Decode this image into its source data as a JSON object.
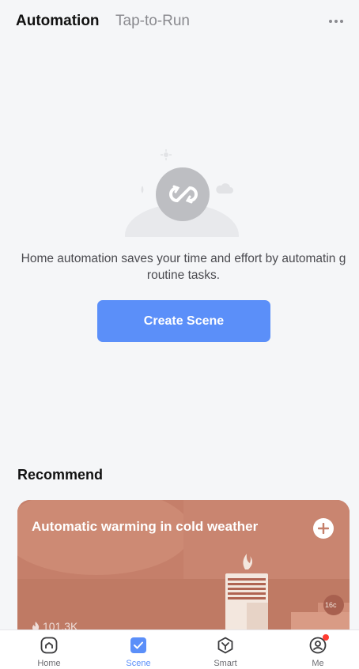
{
  "header": {
    "tabs": [
      {
        "label": "Automation",
        "active": true
      },
      {
        "label": "Tap-to-Run",
        "active": false
      }
    ],
    "more_icon": "more-horizontal-icon"
  },
  "empty_state": {
    "illustration_icon": "sync-loop-icon",
    "message": "Home automation saves your time and effort by automatin g routine tasks.",
    "create_button_label": "Create Scene"
  },
  "recommend": {
    "title": "Recommend",
    "cards": [
      {
        "title": "Automatic warming in cold weather",
        "count": "101.3K",
        "temperature_badge": "16c",
        "add_icon": "plus-icon"
      }
    ]
  },
  "tabbar": {
    "items": [
      {
        "label": "Home",
        "icon": "home-icon",
        "active": false
      },
      {
        "label": "Scene",
        "icon": "checkbox-icon",
        "active": true
      },
      {
        "label": "Smart",
        "icon": "cube-icon",
        "active": false
      },
      {
        "label": "Me",
        "icon": "user-icon",
        "active": false,
        "badge": true
      }
    ]
  },
  "colors": {
    "accent": "#5b8ff9",
    "card_bg": "#c57f6a",
    "badge_red": "#ff3b30"
  }
}
